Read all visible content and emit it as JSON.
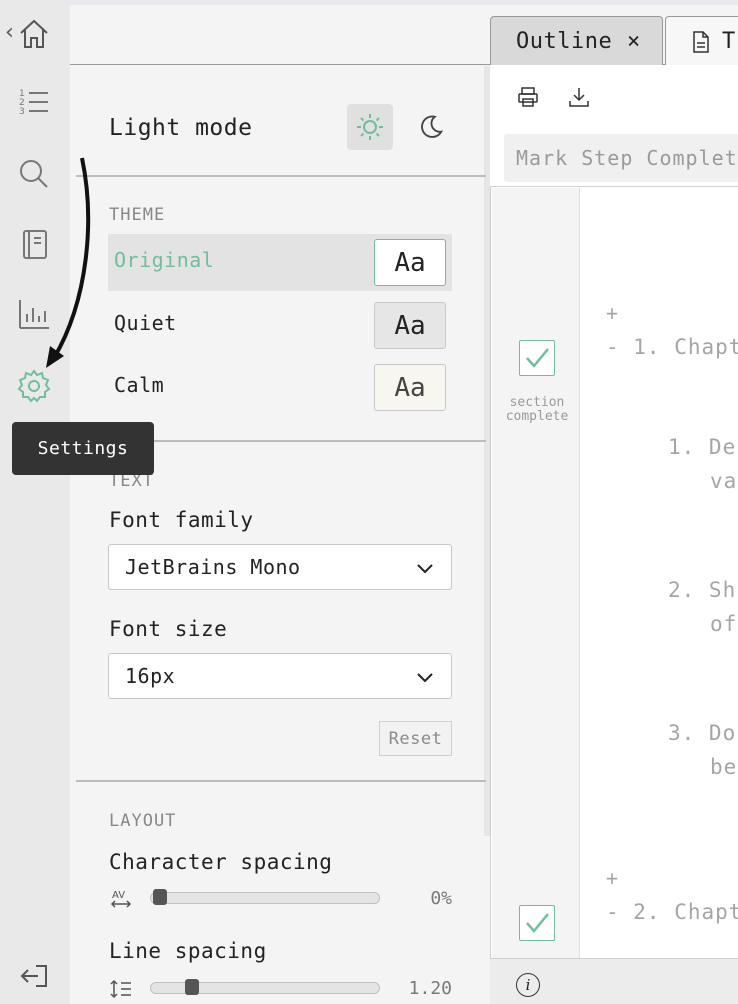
{
  "colors": {
    "accent_green": "#6fbf9b",
    "rail_bg": "#e9e9e9",
    "panel_bg": "#f4f4f4",
    "tooltip_bg": "#333333"
  },
  "rail": {
    "icons": [
      "home-icon",
      "list-icon",
      "search-icon",
      "notebook-icon",
      "stats-icon",
      "settings-icon",
      "logout-icon"
    ],
    "back_glyph": "‹"
  },
  "tooltip": {
    "text": "Settings"
  },
  "settings": {
    "mode_label": "Light mode",
    "theme_heading": "THEME",
    "themes": [
      {
        "name": "Original",
        "sample": "Aa",
        "selected": true
      },
      {
        "name": "Quiet",
        "sample": "Aa",
        "selected": false
      },
      {
        "name": "Calm",
        "sample": "Aa",
        "selected": false
      }
    ],
    "text_heading": "TEXT",
    "font_family_label": "Font family",
    "font_family_value": "JetBrains Mono",
    "font_size_label": "Font size",
    "font_size_value": "16px",
    "reset_label": "Reset",
    "layout_heading": "LAYOUT",
    "char_spacing_label": "Character spacing",
    "char_spacing_value": "0%",
    "char_spacing_level": 0,
    "line_spacing_label": "Line spacing",
    "line_spacing_value": "1.20",
    "line_spacing_level": 0.15
  },
  "tabs": [
    {
      "label": "Outline",
      "close": "×"
    },
    {
      "label": "T"
    }
  ],
  "toolbar": {
    "print_icon": "print-icon",
    "download_icon": "download-icon",
    "mark_step_placeholder": "Mark Step Complet"
  },
  "outline": {
    "plus_1": "+",
    "chapter_1": "- 1. Chapt",
    "section_complete": "section complete",
    "item_1_line1": "1. De",
    "item_1_line2": "va",
    "item_2_line1": "2. Sh",
    "item_2_line2": "of",
    "item_3_line1": "3. Do",
    "item_3_line2": "be",
    "plus_2": "+",
    "chapter_2": "- 2. Chapt"
  },
  "bottombar": {
    "info_glyph": "i"
  }
}
